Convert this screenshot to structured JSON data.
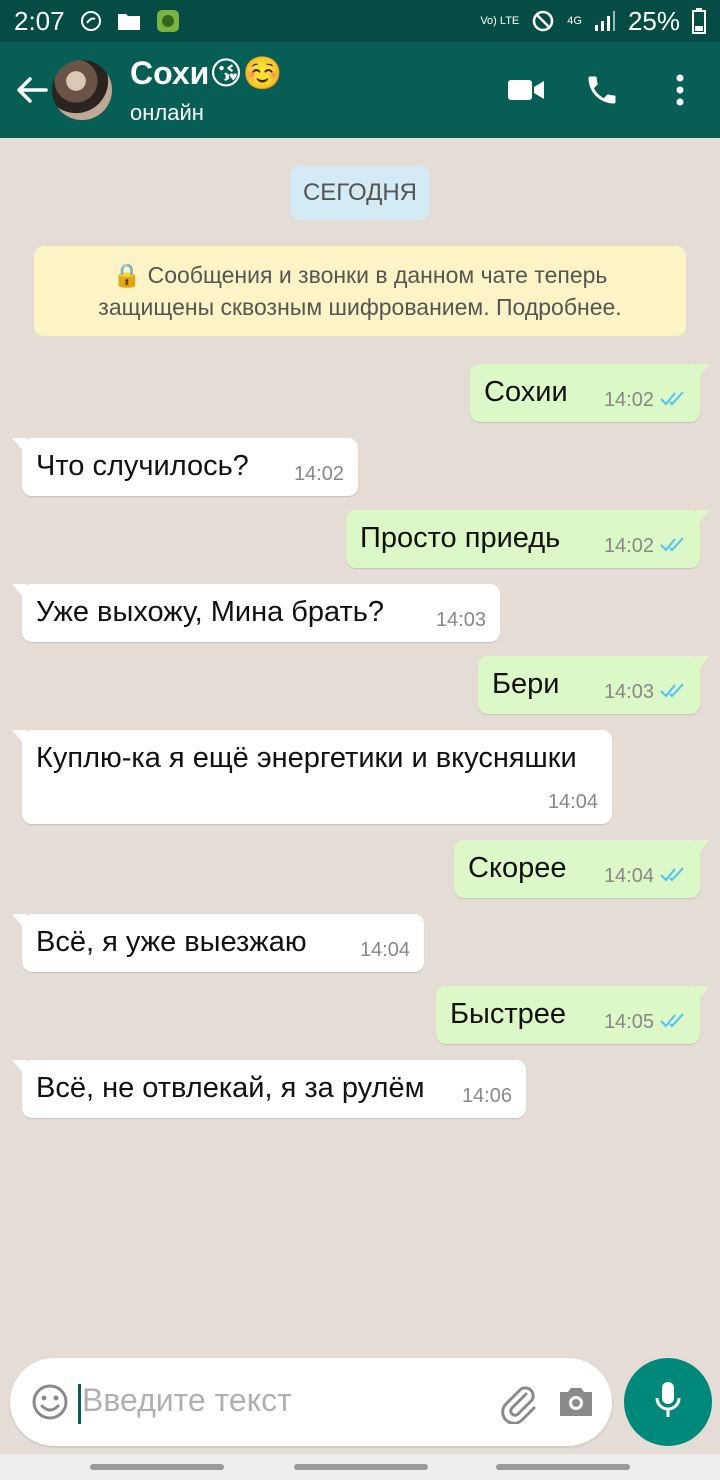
{
  "status_bar": {
    "time": "2:07",
    "volte_label": "Vo) LTE",
    "network_label": "4G",
    "battery": "25%",
    "icons": [
      "whatsapp-notification-icon",
      "folder-icon",
      "game-icon",
      "volte-icon",
      "no-disturb-icon",
      "signal-icon",
      "battery-icon"
    ]
  },
  "header": {
    "contact_name": "Сохи😘☺️",
    "status": "онлайн",
    "icons": [
      "back-arrow-icon",
      "video-call-icon",
      "phone-icon",
      "more-vert-icon"
    ]
  },
  "chat": {
    "date_label": "СЕГОДНЯ",
    "encryption_notice": "🔒 Сообщения и звонки в данном чате теперь защищены сквозным шифрованием. Подробнее.",
    "messages": [
      {
        "direction": "out",
        "text": "Сохии",
        "time": "14:02",
        "read": true
      },
      {
        "direction": "in",
        "text": "Что случилось?",
        "time": "14:02"
      },
      {
        "direction": "out",
        "text": "Просто приедь",
        "time": "14:02",
        "read": true
      },
      {
        "direction": "in",
        "text": "Уже выхожу, Мина брать?",
        "time": "14:03"
      },
      {
        "direction": "out",
        "text": "Бери",
        "time": "14:03",
        "read": true
      },
      {
        "direction": "in",
        "text": "Куплю-ка я ещё энергетики и вкусняшки",
        "time": "14:04"
      },
      {
        "direction": "out",
        "text": "Скорее",
        "time": "14:04",
        "read": true
      },
      {
        "direction": "in",
        "text": "Всё, я уже выезжаю",
        "time": "14:04"
      },
      {
        "direction": "out",
        "text": "Быстрее",
        "time": "14:05",
        "read": true
      },
      {
        "direction": "in",
        "text": "Всё, не отвлекай, я за рулём",
        "time": "14:06"
      }
    ]
  },
  "composer": {
    "placeholder": "Введите текст",
    "icons": [
      "emoji-icon",
      "attach-icon",
      "camera-icon",
      "mic-icon"
    ]
  },
  "colors": {
    "header": "#075e54",
    "status_bar": "#054d44",
    "outgoing_bubble": "#dcf8c6",
    "incoming_bubble": "#ffffff",
    "read_ticks": "#4fc3f7",
    "mic_button": "#00897b"
  }
}
